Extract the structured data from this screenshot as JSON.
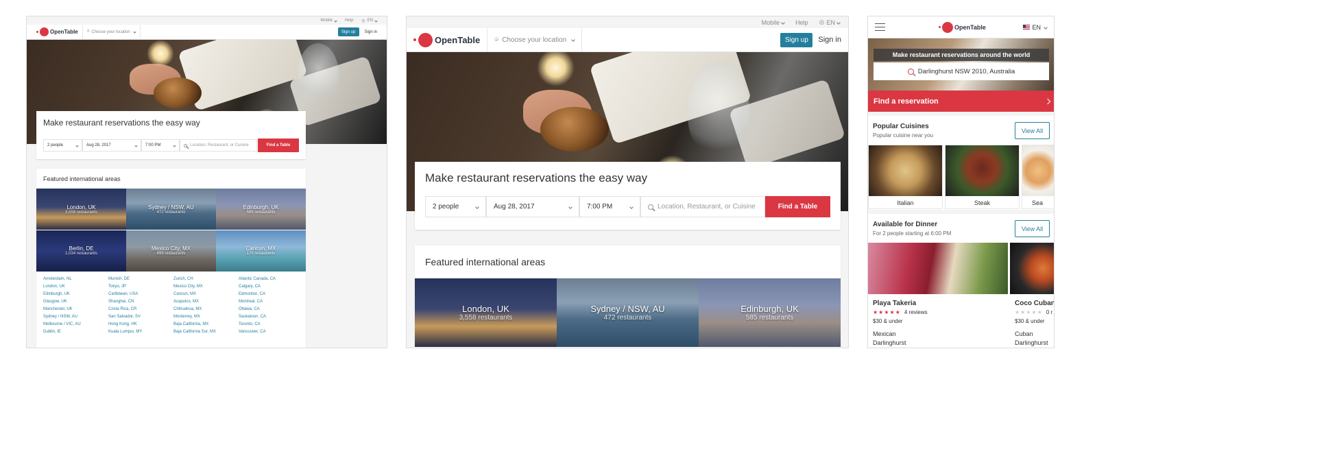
{
  "brand": {
    "name": "OpenTable",
    "accent": "#da3743",
    "link": "#247f9e"
  },
  "utility": {
    "mobile": "Mobile",
    "help": "Help",
    "lang": "EN"
  },
  "nav": {
    "location_placeholder": "Choose your location",
    "signup": "Sign up",
    "signin": "Sign in"
  },
  "search": {
    "headline": "Make restaurant reservations the easy way",
    "party": "2 people",
    "date": "Aug 28, 2017",
    "time": "7:00 PM",
    "query_placeholder": "Location, Restaurant, or Cuisine",
    "submit": "Find a Table"
  },
  "featured": {
    "title": "Featured international areas",
    "tiles": [
      {
        "city": "London, UK",
        "count": "3,558 restaurants"
      },
      {
        "city": "Sydney / NSW, AU",
        "count": "472 restaurants"
      },
      {
        "city": "Edinburgh, UK",
        "count": "585 restaurants"
      },
      {
        "city": "Berlin, DE",
        "count": "1,034 restaurants"
      },
      {
        "city": "Mexico City, MX",
        "count": "499 restaurants"
      },
      {
        "city": "Cancun, MX",
        "count": "175 restaurants"
      }
    ],
    "links": [
      [
        "Amsterdam, NL",
        "Munich, DE",
        "Zurich, CH",
        "Atlantic Canada, CA"
      ],
      [
        "London, UK",
        "Tokyo, JP",
        "Mexico City, MX",
        "Calgary, CA"
      ],
      [
        "Edinburgh, UK",
        "Caribbean, USA",
        "Cancun, MX",
        "Edmonton, CA"
      ],
      [
        "Glasgow, UK",
        "Shanghai, CN",
        "Acapulco, MX",
        "Montreal, CA"
      ],
      [
        "Manchester, UK",
        "Costa Rica, CR",
        "Chihuahua, MX",
        "Ottawa, CA"
      ],
      [
        "Sydney / NSW, AU",
        "San Salvador, SV",
        "Monterrey, MX",
        "Saskatoon, CA"
      ],
      [
        "Melbourne / VIC, AU",
        "Hong Kong, HK",
        "Baja California, MX",
        "Toronto, CA"
      ],
      [
        "Dublin, IE",
        "Kuala Lumpur, MY",
        "Baja California Sur, MX",
        "Vancouver, CA"
      ]
    ]
  },
  "mobile": {
    "lang": "EN",
    "banner": "Make restaurant reservations around the world",
    "location_value": "Darlinghurst NSW 2010, Australia",
    "find_reservation": "Find a reservation",
    "popular": {
      "title": "Popular Cuisines",
      "subtitle": "Popular cuisine near you",
      "view_all": "View All",
      "items": [
        "Italian",
        "Steak",
        "Sea"
      ]
    },
    "dinner": {
      "title": "Available for Dinner",
      "subtitle": "For 2 people starting at 6:00 PM",
      "view_all": "View All",
      "restaurants": [
        {
          "name": "Playa Takeria",
          "stars": "★★★★★",
          "reviews": "4 reviews",
          "price": "$30 & under",
          "cuisine": "Mexican",
          "area": "Darlinghurst"
        },
        {
          "name": "Coco Cubano",
          "stars": "★★★★★",
          "reviews": "0 r",
          "price": "$30 & under",
          "cuisine": "Cuban",
          "area": "Darlinghurst"
        }
      ]
    }
  }
}
